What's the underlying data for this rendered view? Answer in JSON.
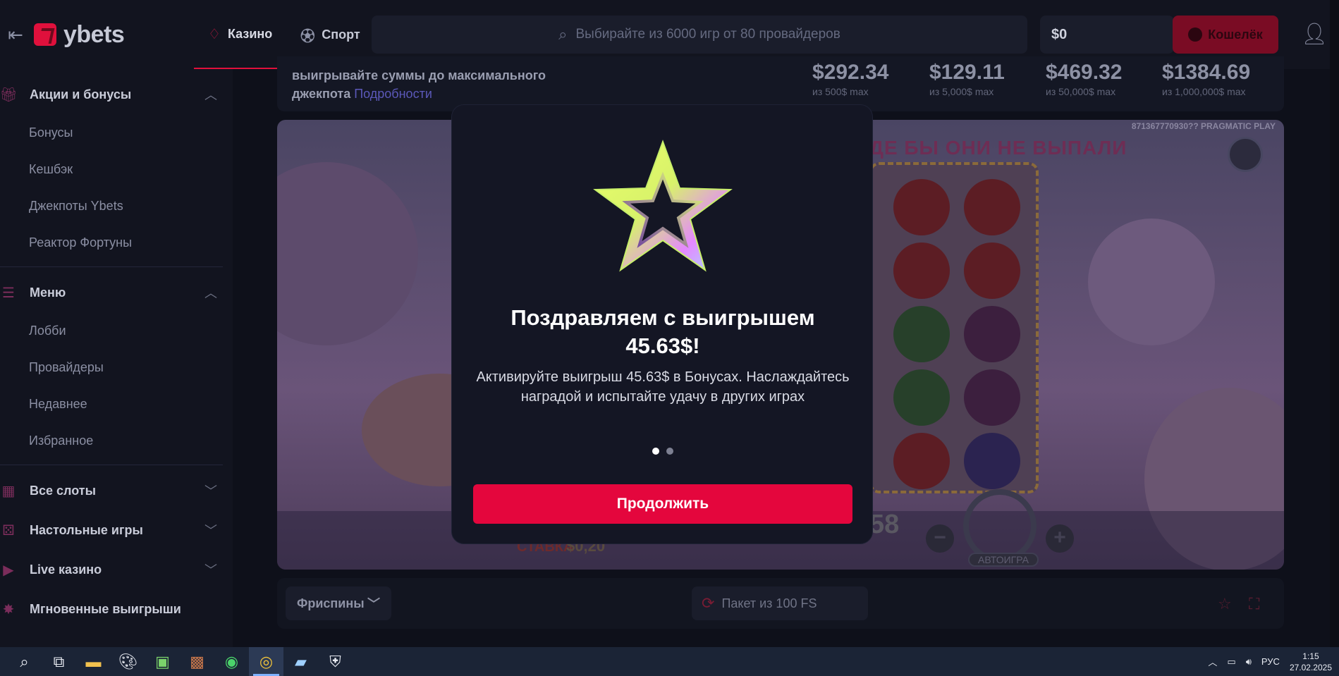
{
  "sidebar": {
    "logo_text": "ybets",
    "sections": [
      {
        "title": "Акции и бонусы",
        "icon": "gift-icon",
        "expanded": true,
        "items": [
          "Бонусы",
          "Кешбэк",
          "Джекпоты Ybets",
          "Реактор Фортуны"
        ]
      },
      {
        "title": "Меню",
        "icon": "menu-search-icon",
        "expanded": true,
        "items": [
          "Лобби",
          "Провайдеры",
          "Недавнее",
          "Избранное"
        ]
      }
    ],
    "collapsed_sections": [
      {
        "title": "Все слоты",
        "icon": "grid-icon"
      },
      {
        "title": "Настольные игры",
        "icon": "dice-icon"
      },
      {
        "title": "Live казино",
        "icon": "play-icon"
      },
      {
        "title": "Мгновенные выигрыши",
        "icon": "burst-icon"
      }
    ]
  },
  "header": {
    "tabs": [
      {
        "label": "Казино",
        "icon": "casino-chip-icon",
        "active": true
      },
      {
        "label": "Спорт",
        "icon": "ball-icon",
        "active": false
      }
    ],
    "search_placeholder": "Выбирайте из 6000 игр от 80 провайдеров",
    "balance": "$0",
    "wallet_label": "Кошелёк"
  },
  "jackpot": {
    "text_line1": "выигрывайте суммы до максимального",
    "text_line2": "джекпота",
    "link": "Подробности",
    "cards": [
      {
        "amount": "$292.34",
        "sub": "из 500$ max"
      },
      {
        "amount": "$129.11",
        "sub": "из 5,000$ max"
      },
      {
        "amount": "$469.32",
        "sub": "из 50,000$ max"
      },
      {
        "amount": "$1384.69",
        "sub": "из 1,000,000$ max"
      }
    ]
  },
  "game": {
    "provider_text": "871367770930?? PRAGMATIC PLAY",
    "banner_text": "ДЕ БЫ ОНИ НЕ ВЫПАЛИ",
    "bet_label": "СТАВКА",
    "bet_value": "$0,20",
    "win_value": "58",
    "autoplay_label": "АВТОИГРА"
  },
  "controls": {
    "select_label": "Фриспины",
    "pack_label": "Пакет из 100 FS"
  },
  "modal": {
    "title": "Поздравляем с выигрышем 45.63$!",
    "desc": "Активируйте выигрыш 45.63$ в Бонусах. Наслаждайтесь наградой и испытайте удачу в других играх",
    "button": "Продолжить",
    "slides_total": 2,
    "slide_active": 1
  },
  "taskbar": {
    "lang": "РУС",
    "time": "1:15",
    "date": "27.02.2025"
  },
  "colors": {
    "accent": "#e4063d",
    "modal_bg": "#141624",
    "app_bg": "#0e101a"
  }
}
